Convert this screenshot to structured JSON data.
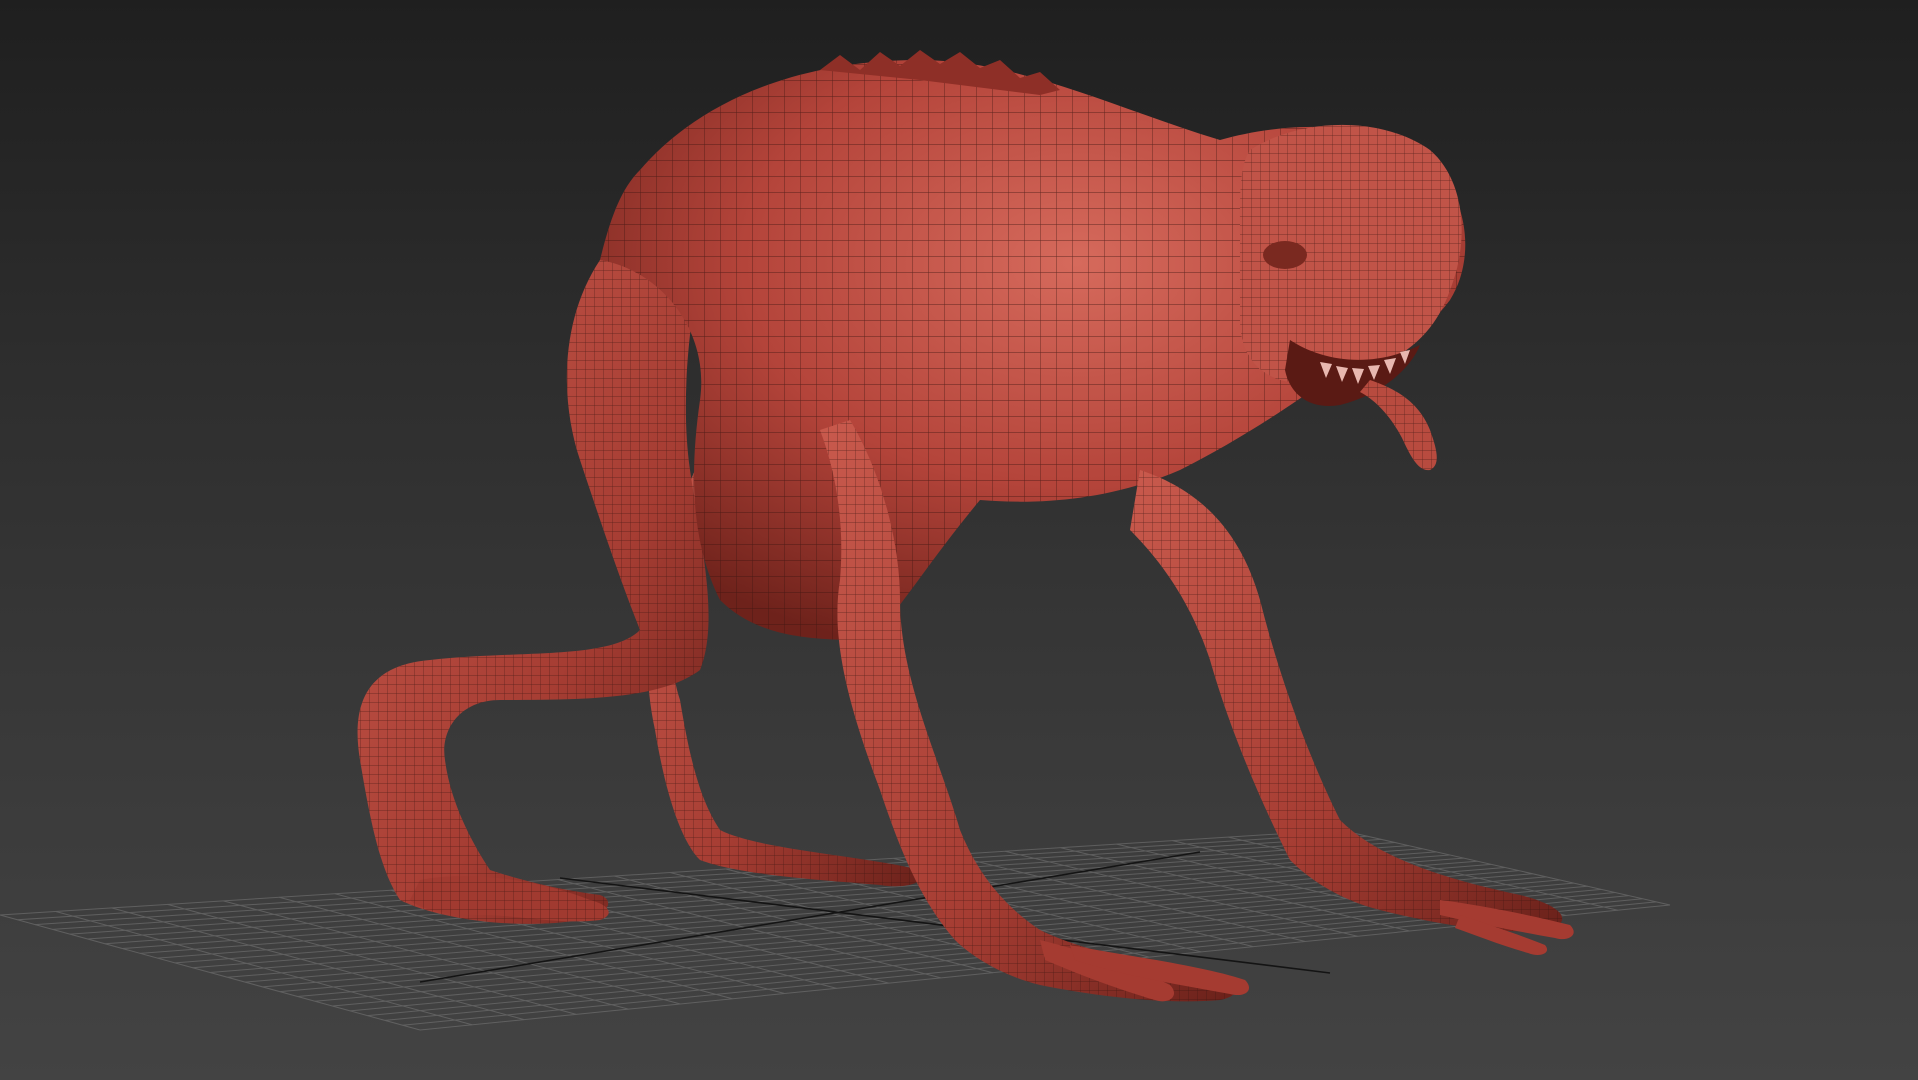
{
  "viewport": {
    "background_top": "#1f1f1f",
    "background_bottom": "#434343",
    "grid_color": "#7a7a7a",
    "grid_axis_color": "#141414"
  },
  "model": {
    "mesh_color": "#b9483b",
    "mesh_shadow": "#6e221b",
    "mesh_highlight": "#d9766a",
    "wire_color": "#3a1410",
    "display_mode": "smooth-shaded-with-wireframe"
  }
}
